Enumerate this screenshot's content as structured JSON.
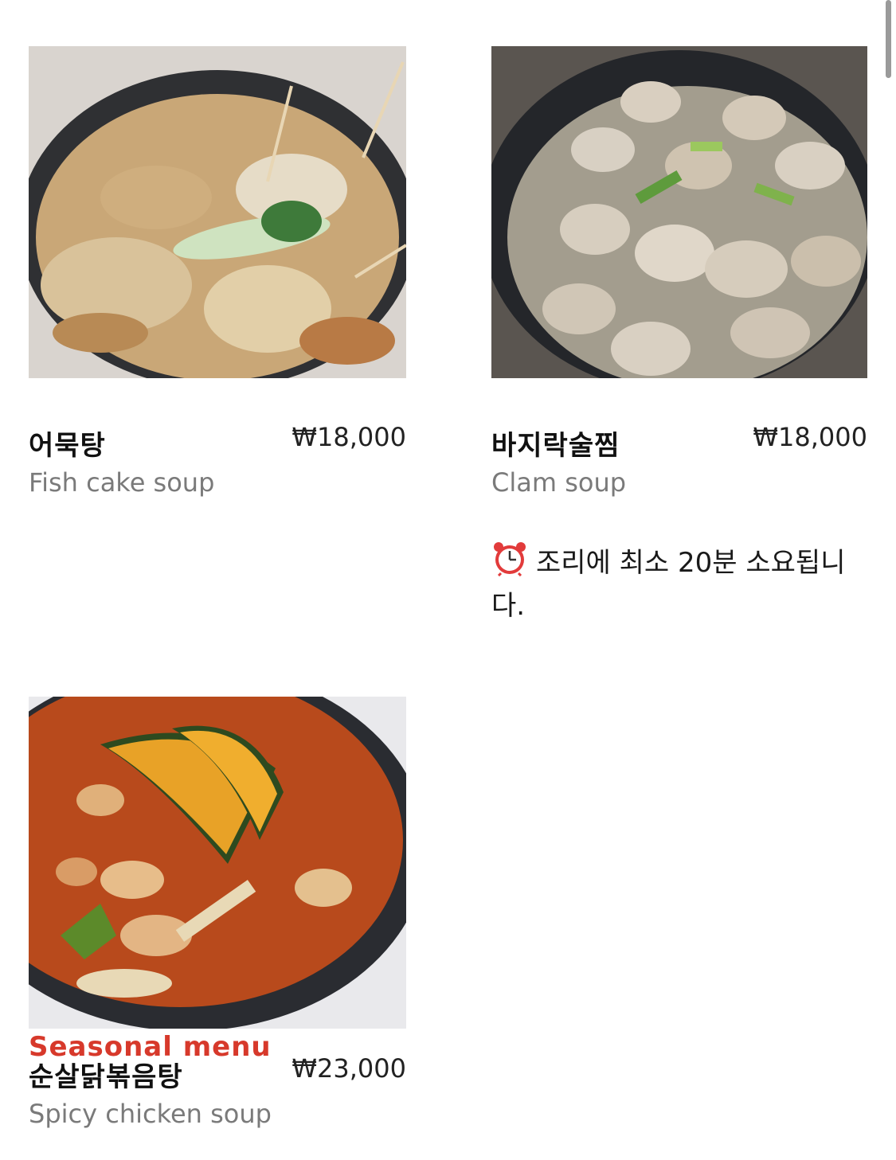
{
  "items": [
    {
      "name": "어묵탕",
      "price": "₩18,000",
      "description": "Fish cake soup"
    },
    {
      "name": "바지락술찜",
      "price": "₩18,000",
      "description": "Clam soup",
      "note": "조리에 최소 20분 소요됩니다.",
      "note_icon": "alarm-clock-icon"
    },
    {
      "badge": "Seasonal menu",
      "name": "순살닭볶음탕",
      "price": "₩23,000",
      "description": "Spicy chicken soup"
    }
  ],
  "colors": {
    "badge": "#d7392b",
    "price": "#222222",
    "description": "#7a7a7a"
  }
}
